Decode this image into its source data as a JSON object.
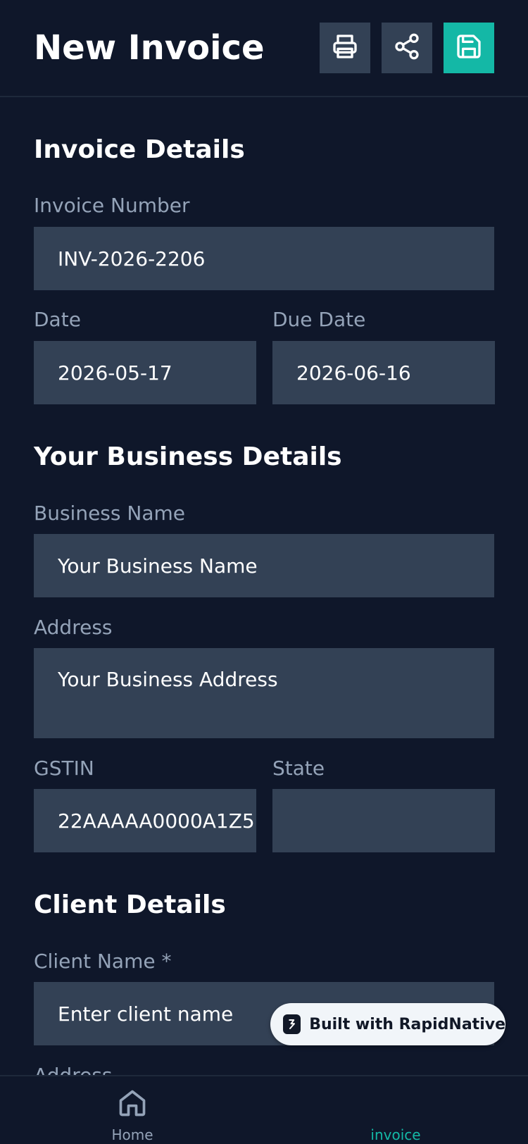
{
  "header": {
    "title": "New Invoice",
    "print_icon": "printer-icon",
    "share_icon": "share-icon",
    "save_icon": "save-icon"
  },
  "invoice_details": {
    "title": "Invoice Details",
    "invoice_number_label": "Invoice Number",
    "invoice_number_value": "INV-2026-2206",
    "date_label": "Date",
    "date_value": "2026-05-17",
    "due_date_label": "Due Date",
    "due_date_value": "2026-06-16"
  },
  "business_details": {
    "title": "Your Business Details",
    "business_name_label": "Business Name",
    "business_name_value": "Your Business Name",
    "address_label": "Address",
    "address_value": "Your Business Address",
    "gstin_label": "GSTIN",
    "gstin_value": "22AAAAA0000A1Z5",
    "state_label": "State",
    "state_value": ""
  },
  "client_details": {
    "title": "Client Details",
    "client_name_label": "Client Name *",
    "client_name_placeholder": "Enter client name",
    "address_label": "Address"
  },
  "badge": {
    "text": "Built with RapidNative"
  },
  "bottom_nav": {
    "home_label": "Home",
    "invoice_label": "invoice"
  },
  "colors": {
    "background": "#0f172a",
    "field": "#334155",
    "accent": "#14b8a6",
    "label": "#94a3b8"
  }
}
